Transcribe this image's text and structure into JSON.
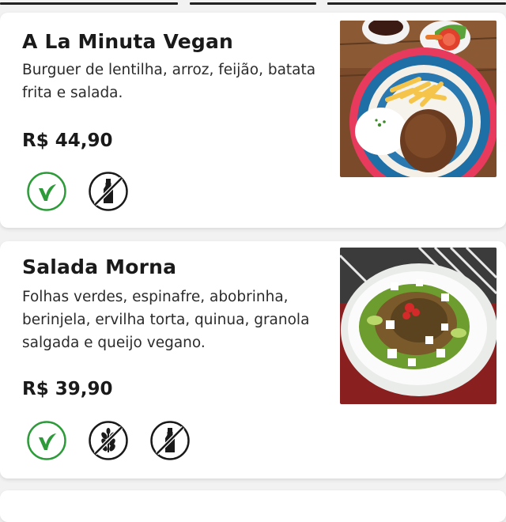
{
  "menu": {
    "items": [
      {
        "title": "A La Minuta Vegan",
        "description_lines": [
          "Burguer de lentilha, arroz, feijão, batata",
          "frita e salada."
        ],
        "price": "R$ 44,90",
        "badges": [
          "vegan-leaf-icon",
          "no-milk-icon"
        ]
      },
      {
        "title": "Salada Morna",
        "description_lines": [
          "Folhas verdes, espinafre, abobrinha,",
          "berinjela, ervilha torta, quinua, granola",
          "salgada e queijo vegano."
        ],
        "price": "R$ 39,90",
        "badges": [
          "vegan-leaf-icon",
          "no-gluten-icon",
          "no-milk-icon"
        ]
      }
    ]
  },
  "colors": {
    "vegan_green": "#2e9b3a",
    "icon_dark": "#1a1a1a",
    "card_bg": "#ffffff",
    "page_bg": "#f2f2f2"
  }
}
